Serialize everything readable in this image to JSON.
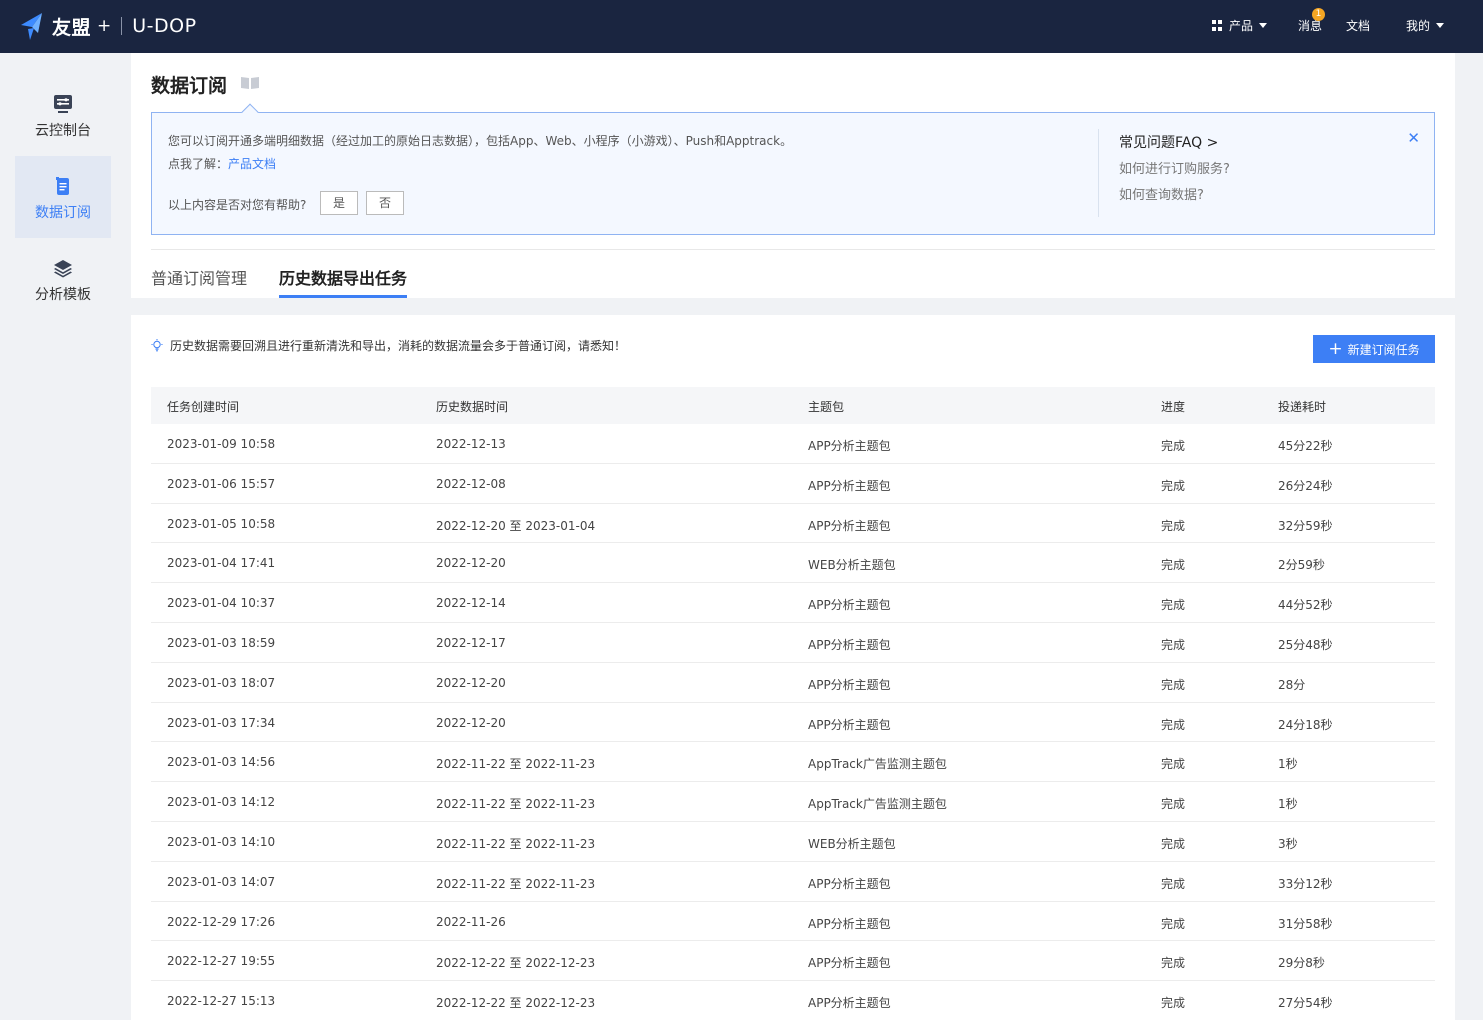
{
  "topbar": {
    "brand": "友盟",
    "brand_plus": "+",
    "product_name": "U-DOP",
    "nav": {
      "products": "产品",
      "messages": "消息",
      "message_badge": "1",
      "docs": "文档",
      "mine": "我的"
    }
  },
  "sidebar": {
    "items": [
      {
        "label": "云控制台",
        "icon": "console-icon",
        "active": false
      },
      {
        "label": "数据订阅",
        "icon": "document-icon",
        "active": true
      },
      {
        "label": "分析模板",
        "icon": "layers-icon",
        "active": false
      }
    ]
  },
  "header": {
    "title": "数据订阅"
  },
  "info": {
    "line1": "您可以订阅开通多端明细数据（经过加工的原始日志数据），包括App、Web、小程序（小游戏）、Push和Apptrack。",
    "line2_prefix": "点我了解：",
    "line2_link": "产品文档",
    "helpful_question": "以上内容是否对您有帮助?",
    "yes": "是",
    "no": "否",
    "faq_title": "常见问题FAQ >",
    "faq_items": [
      "如何进行订购服务?",
      "如何查询数据?"
    ]
  },
  "tabs": [
    {
      "label": "普通订阅管理",
      "active": false
    },
    {
      "label": "历史数据导出任务",
      "active": true
    }
  ],
  "main": {
    "notice": "历史数据需要回溯且进行重新清洗和导出，消耗的数据流量会多于普通订阅，请悉知！",
    "new_button": "新建订阅任务",
    "table": {
      "columns": [
        "任务创建时间",
        "历史数据时间",
        "主题包",
        "进度",
        "投递耗时"
      ],
      "rows": [
        [
          "2023-01-09 10:58",
          "2022-12-13",
          "APP分析主题包",
          "完成",
          "45分22秒"
        ],
        [
          "2023-01-06 15:57",
          "2022-12-08",
          "APP分析主题包",
          "完成",
          "26分24秒"
        ],
        [
          "2023-01-05 10:58",
          "2022-12-20 至 2023-01-04",
          "APP分析主题包",
          "完成",
          "32分59秒"
        ],
        [
          "2023-01-04 17:41",
          "2022-12-20",
          "WEB分析主题包",
          "完成",
          "2分59秒"
        ],
        [
          "2023-01-04 10:37",
          "2022-12-14",
          "APP分析主题包",
          "完成",
          "44分52秒"
        ],
        [
          "2023-01-03 18:59",
          "2022-12-17",
          "APP分析主题包",
          "完成",
          "25分48秒"
        ],
        [
          "2023-01-03 18:07",
          "2022-12-20",
          "APP分析主题包",
          "完成",
          "28分"
        ],
        [
          "2023-01-03 17:34",
          "2022-12-20",
          "APP分析主题包",
          "完成",
          "24分18秒"
        ],
        [
          "2023-01-03 14:56",
          "2022-11-22 至 2022-11-23",
          "AppTrack广告监测主题包",
          "完成",
          "1秒"
        ],
        [
          "2023-01-03 14:12",
          "2022-11-22 至 2022-11-23",
          "AppTrack广告监测主题包",
          "完成",
          "1秒"
        ],
        [
          "2023-01-03 14:10",
          "2022-11-22 至 2022-11-23",
          "WEB分析主题包",
          "完成",
          "3秒"
        ],
        [
          "2023-01-03 14:07",
          "2022-11-22 至 2022-11-23",
          "APP分析主题包",
          "完成",
          "33分12秒"
        ],
        [
          "2022-12-29 17:26",
          "2022-11-26",
          "APP分析主题包",
          "完成",
          "31分58秒"
        ],
        [
          "2022-12-27 19:55",
          "2022-12-22 至 2022-12-23",
          "APP分析主题包",
          "完成",
          "29分8秒"
        ],
        [
          "2022-12-27 15:13",
          "2022-12-22 至 2022-12-23",
          "APP分析主题包",
          "完成",
          "27分54秒"
        ]
      ]
    }
  },
  "colors": {
    "topbar_bg": "#1a2540",
    "accent": "#3d7ff5",
    "badge": "#f5a623"
  }
}
